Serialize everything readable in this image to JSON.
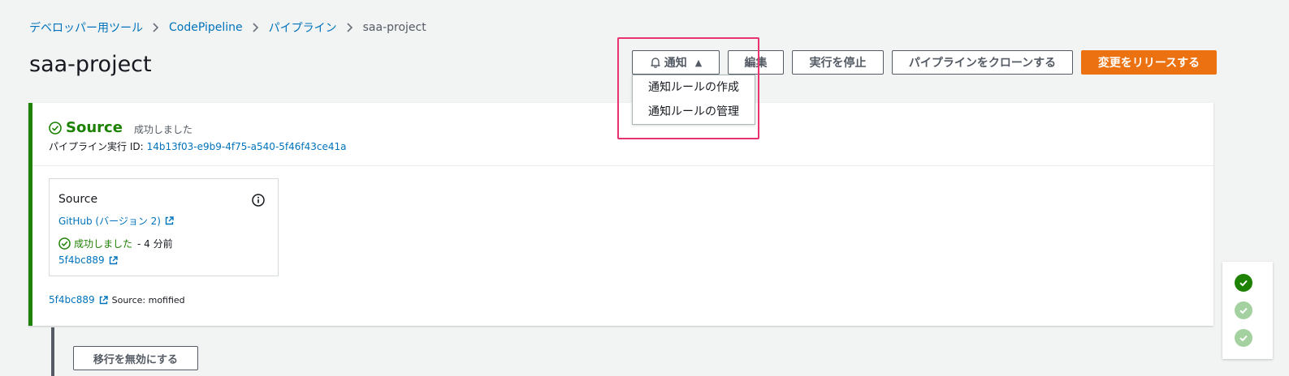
{
  "breadcrumb": {
    "items": [
      "デベロッパー用ツール",
      "CodePipeline",
      "パイプライン"
    ],
    "current": "saa-project"
  },
  "page": {
    "title": "saa-project"
  },
  "header_buttons": {
    "notify": "通知",
    "edit": "編集",
    "stop": "実行を停止",
    "clone": "パイプラインをクローンする",
    "release": "変更をリリースする"
  },
  "notify_menu": {
    "items": [
      "通知ルールの作成",
      "通知ルールの管理"
    ]
  },
  "stage": {
    "name": "Source",
    "status": "成功しました",
    "exec_label": "パイプライン実行 ID:",
    "exec_id": "14b13f03-e9b9-4f75-a540-5f46f43ce41a",
    "action": {
      "title": "Source",
      "provider": "GitHub (バージョン 2)",
      "status": "成功しました",
      "time": "- 4 分前",
      "commit": "5f4bc889"
    },
    "source_commit": "5f4bc889",
    "source_message": "Source: mofified"
  },
  "transition": {
    "button": "移行を無効にする"
  },
  "colors": {
    "success": "#1d8102",
    "link": "#0073bb",
    "primary": "#ec7211",
    "highlight": "#e8336e"
  }
}
